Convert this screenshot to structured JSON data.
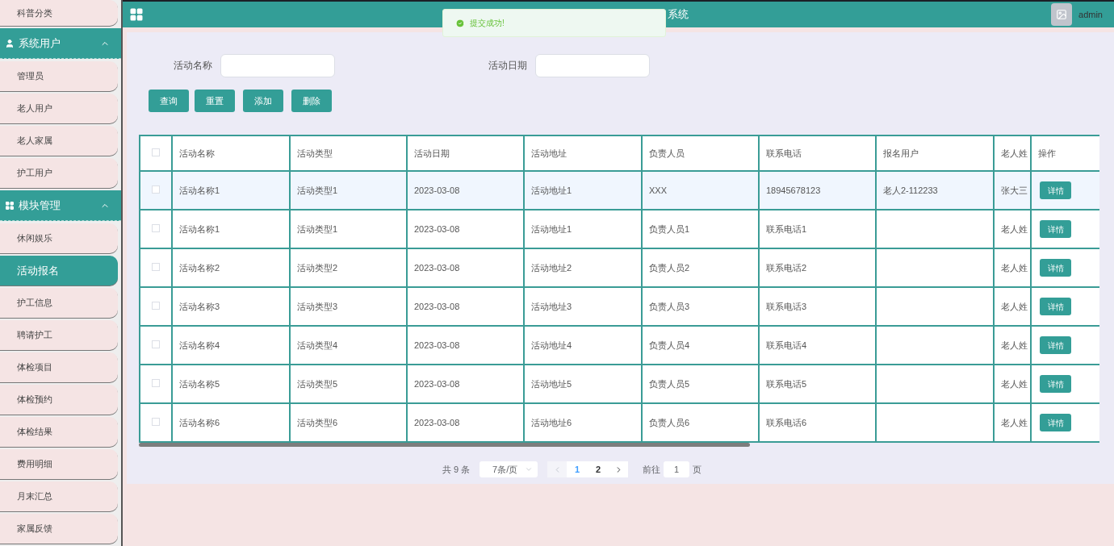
{
  "sidebar": {
    "items": [
      {
        "label": "科普分类",
        "selected": false
      }
    ],
    "groups": [
      {
        "title": "系统用户",
        "kind": "user",
        "expanded": true,
        "items": [
          {
            "label": "管理员",
            "selected": false
          },
          {
            "label": "老人用户",
            "selected": false
          },
          {
            "label": "老人家属",
            "selected": false
          },
          {
            "label": "护工用户",
            "selected": false
          }
        ]
      },
      {
        "title": "模块管理",
        "kind": "grid",
        "expanded": true,
        "items": [
          {
            "label": "休闲娱乐",
            "selected": false
          },
          {
            "label": "活动报名",
            "selected": true
          },
          {
            "label": "护工信息",
            "selected": false
          },
          {
            "label": "聘请护工",
            "selected": false
          },
          {
            "label": "体检项目",
            "selected": false
          },
          {
            "label": "体检预约",
            "selected": false
          },
          {
            "label": "体检结果",
            "selected": false
          },
          {
            "label": "费用明细",
            "selected": false
          },
          {
            "label": "月末汇总",
            "selected": false
          },
          {
            "label": "家属反馈",
            "selected": false
          }
        ]
      }
    ]
  },
  "header": {
    "title": "系统",
    "user": "admin"
  },
  "toast": {
    "message": "提交成功!"
  },
  "search": {
    "fields": [
      {
        "label": "活动名称"
      },
      {
        "label": "活动日期"
      }
    ],
    "buttons": [
      "查询",
      "重置",
      "添加",
      "删除"
    ]
  },
  "table": {
    "all_checked": false,
    "columns": [
      "活动名称",
      "活动类型",
      "活动日期",
      "活动地址",
      "负责人员",
      "联系电话",
      "报名用户",
      "老人姓",
      "操作"
    ],
    "rows": [
      {
        "checked": false,
        "highlighted": true,
        "cells": [
          "活动名称1",
          "活动类型1",
          "2023-03-08",
          "活动地址1",
          "XXX",
          "18945678123",
          "老人2-112233",
          "张大三"
        ],
        "action": "详情"
      },
      {
        "checked": false,
        "highlighted": false,
        "cells": [
          "活动名称1",
          "活动类型1",
          "2023-03-08",
          "活动地址1",
          "负责人员1",
          "联系电话1",
          "",
          "老人姓"
        ],
        "action": "详情"
      },
      {
        "checked": false,
        "highlighted": false,
        "cells": [
          "活动名称2",
          "活动类型2",
          "2023-03-08",
          "活动地址2",
          "负责人员2",
          "联系电话2",
          "",
          "老人姓"
        ],
        "action": "详情"
      },
      {
        "checked": false,
        "highlighted": false,
        "cells": [
          "活动名称3",
          "活动类型3",
          "2023-03-08",
          "活动地址3",
          "负责人员3",
          "联系电话3",
          "",
          "老人姓"
        ],
        "action": "详情"
      },
      {
        "checked": false,
        "highlighted": false,
        "cells": [
          "活动名称4",
          "活动类型4",
          "2023-03-08",
          "活动地址4",
          "负责人员4",
          "联系电话4",
          "",
          "老人姓"
        ],
        "action": "详情"
      },
      {
        "checked": false,
        "highlighted": false,
        "cells": [
          "活动名称5",
          "活动类型5",
          "2023-03-08",
          "活动地址5",
          "负责人员5",
          "联系电话5",
          "",
          "老人姓"
        ],
        "action": "详情"
      },
      {
        "checked": false,
        "highlighted": false,
        "cells": [
          "活动名称6",
          "活动类型6",
          "2023-03-08",
          "活动地址6",
          "负责人员6",
          "联系电话6",
          "",
          "老人姓"
        ],
        "action": "详情"
      }
    ]
  },
  "pagination": {
    "total": "共 9 条",
    "page_size": "7条/页",
    "pages": [
      {
        "label": "1",
        "selected": true
      },
      {
        "label": "2",
        "selected": false
      }
    ],
    "goto_label": "前往",
    "goto_value": "1",
    "goto_suffix": "页"
  }
}
